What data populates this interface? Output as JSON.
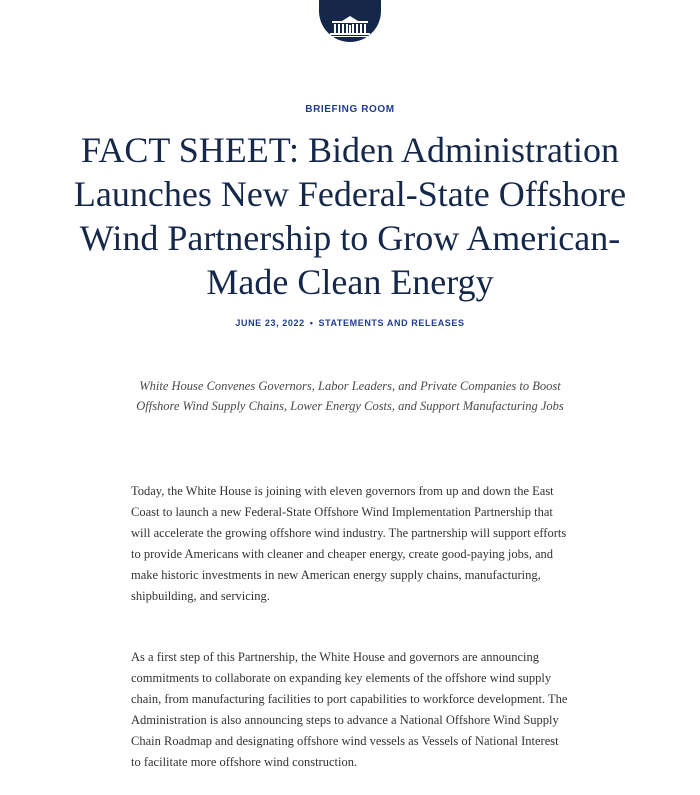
{
  "logo": {
    "icon": "white-house-seal-icon",
    "colors": {
      "background": "#16284a",
      "foreground": "#ffffff"
    }
  },
  "header": {
    "section": "BRIEFING ROOM",
    "title": "FACT SHEET: Biden Administration Launches New Federal-State Offshore Wind Partnership to Grow American-Made Clean Energy",
    "date": "JUNE 23, 2022",
    "separator": "•",
    "category": "STATEMENTS AND RELEASES"
  },
  "article": {
    "subtitle": "White House Convenes Governors, Labor Leaders, and Private Companies to Boost Offshore Wind Supply Chains, Lower Energy Costs, and Support Manufacturing Jobs",
    "paragraphs": [
      "Today, the White House is joining with eleven governors from up and down the East Coast to launch a new Federal-State Offshore Wind Implementation Partnership that will accelerate the growing offshore wind industry. The partnership will support efforts to provide Americans with cleaner and cheaper energy, create good-paying jobs, and make historic investments in new American energy supply chains, manufacturing, shipbuilding, and servicing.",
      "As a first step of this Partnership, the White House and governors are announcing commitments to collaborate on expanding key elements of the offshore wind supply chain, from manufacturing facilities to port capabilities to workforce development. The Administration is also announcing steps to advance a National Offshore Wind Supply Chain Roadmap and designating offshore wind vessels as Vessels of National Interest to facilitate more offshore wind construction."
    ]
  },
  "colors": {
    "accent": "#1e3d8f",
    "title": "#16284a",
    "body": "#333333"
  }
}
